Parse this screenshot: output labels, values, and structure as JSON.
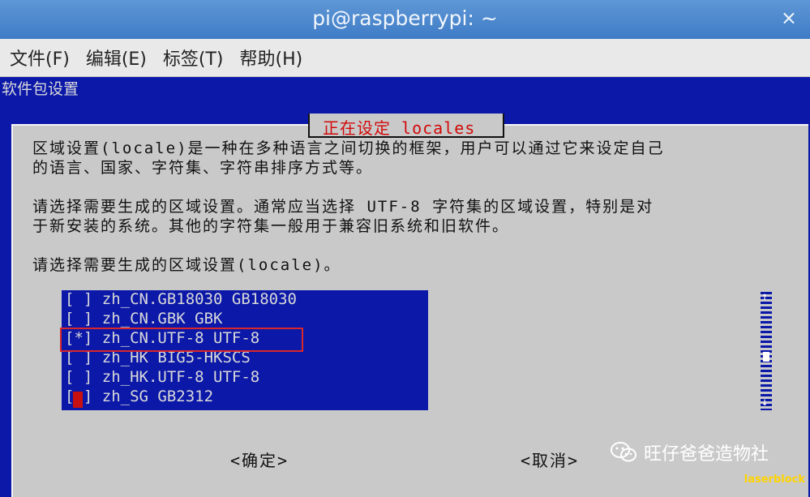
{
  "window": {
    "title": "pi@raspberrypi: ~",
    "close_label": "×"
  },
  "menu": [
    "文件(F)",
    "编辑(E)",
    "标签(T)",
    "帮助(H)"
  ],
  "terminal": {
    "header": "软件包设置"
  },
  "dialog": {
    "title": "正在设定 locales",
    "paragraphs": [
      "区域设置(locale)是一种在多种语言之间切换的框架，用户可以通过它来设定自己",
      "的语言、国家、字符集、字符串排序方式等。",
      "请选择需要生成的区域设置。通常应当选择 UTF-8 字符集的区域设置，特别是对",
      "于新安装的系统。其他的字符集一般用于兼容旧系统和旧软件。",
      "请选择需要生成的区域设置(locale)。"
    ],
    "options": [
      "[ ] zh_CN.GB18030 GB18030",
      "[ ] zh_CN.GBK GBK",
      "[*] zh_CN.UTF-8 UTF-8",
      "[ ] zh_HK BIG5-HKSCS",
      "[ ] zh_HK.UTF-8 UTF-8",
      "[ ] zh_SG GB2312"
    ],
    "ok_label": "<确定>",
    "cancel_label": "<取消>",
    "scroll": {
      "up": "↑",
      "down": "↓"
    }
  },
  "watermark": {
    "text": "旺仔爸爸造物社",
    "tag": "laserblock"
  }
}
